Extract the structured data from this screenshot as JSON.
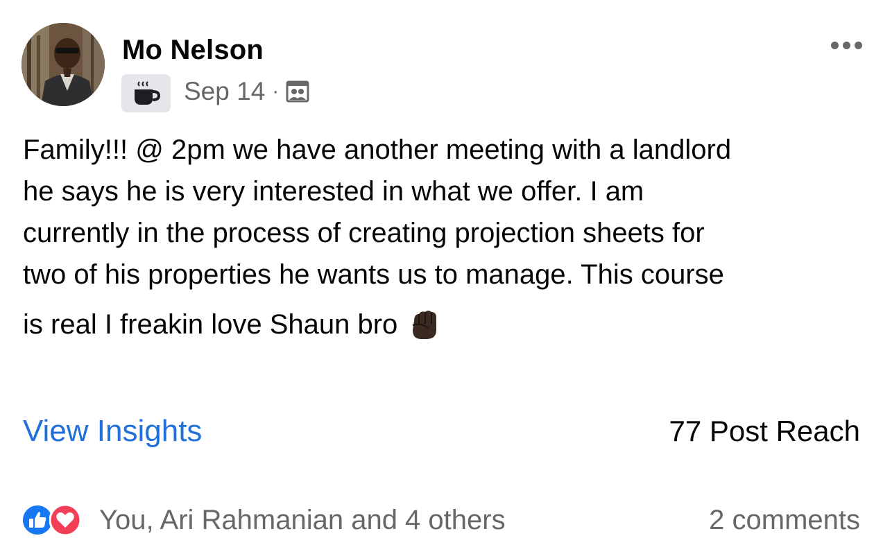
{
  "post": {
    "author_name": "Mo Nelson",
    "date": "Sep 14",
    "separator": "·",
    "badge_icon": "coffee-cup-icon",
    "audience_icon": "group-audience-icon",
    "more_icon": "more-options-icon",
    "body_lines": [
      "Family!!! @ 2pm we have another meeting with a landlord",
      "he says he is very interested in what we offer. I am",
      "currently in the process of creating projection sheets for",
      "two of his properties he wants us to manage. This course",
      "is real I freakin love Shaun bro"
    ],
    "body_emoji": "raised-fist-dark-skin-icon"
  },
  "insights": {
    "link_label": "View Insights",
    "reach_text": "77 Post Reach"
  },
  "footer": {
    "reaction_icons": [
      "like-icon",
      "love-icon"
    ],
    "reactions_text": "You, Ari Rahmanian and 4 others",
    "comments_text": "2 comments"
  },
  "colors": {
    "link_blue": "#216fdb",
    "like_blue": "#1877f2",
    "love_red": "#f33e58",
    "secondary_text": "#65676b",
    "badge_bg": "#e4e6eb"
  }
}
